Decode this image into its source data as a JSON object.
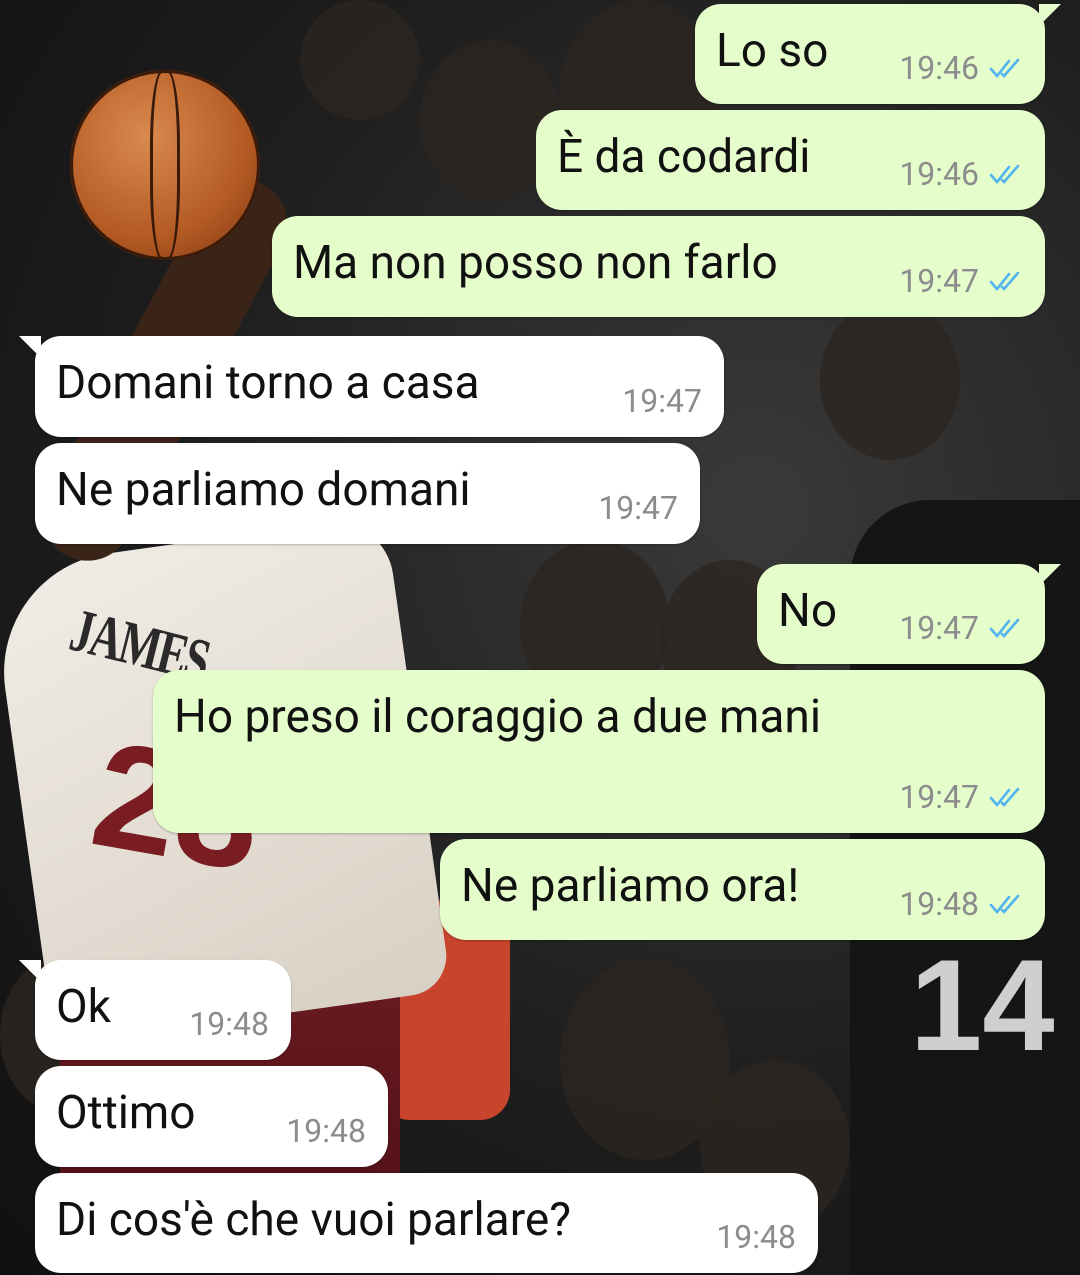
{
  "colors": {
    "outgoing_bubble": "#e4fdcb",
    "incoming_bubble": "#ffffff",
    "read_ticks": "#4fb4f0"
  },
  "background": {
    "jersey_name": "JAMES",
    "jersey_number": "23",
    "opponent_number": "14"
  },
  "messages": [
    {
      "direction": "out",
      "text": "Lo so",
      "time": "19:46",
      "read": true
    },
    {
      "direction": "out",
      "text": "È da codardi",
      "time": "19:46",
      "read": true
    },
    {
      "direction": "out",
      "text": "Ma non posso non farlo",
      "time": "19:47",
      "read": true
    },
    {
      "direction": "in",
      "text": "Domani torno a casa",
      "time": "19:47"
    },
    {
      "direction": "in",
      "text": "Ne parliamo domani",
      "time": "19:47"
    },
    {
      "direction": "out",
      "text": "No",
      "time": "19:47",
      "read": true
    },
    {
      "direction": "out",
      "text": "Ho preso il coraggio a due mani",
      "time": "19:47",
      "read": true
    },
    {
      "direction": "out",
      "text": "Ne parliamo ora!",
      "time": "19:48",
      "read": true
    },
    {
      "direction": "in",
      "text": "Ok",
      "time": "19:48"
    },
    {
      "direction": "in",
      "text": "Ottimo",
      "time": "19:48"
    },
    {
      "direction": "in",
      "text": "Di cos'è che vuoi parlare?",
      "time": "19:48"
    }
  ]
}
